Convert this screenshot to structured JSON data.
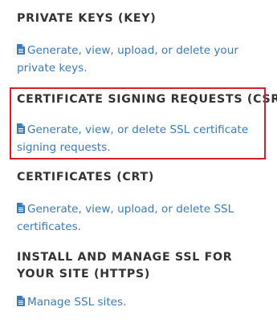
{
  "sections": [
    {
      "title": "PRIVATE KEYS (KEY)",
      "link_text": "Generate, view, upload, or delete your private keys.",
      "icon": "document-icon"
    },
    {
      "title": "CERTIFICATE SIGNING REQUESTS (CSR)",
      "link_text": "Generate, view, or delete SSL certificate signing requests.",
      "icon": "document-icon"
    },
    {
      "title": "CERTIFICATES (CRT)",
      "link_text": "Generate, view, upload, or delete SSL certificates.",
      "icon": "document-icon"
    },
    {
      "title": "INSTALL AND MANAGE SSL FOR YOUR SITE (HTTPS)",
      "link_text": "Manage SSL sites.",
      "icon": "document-icon"
    }
  ],
  "colors": {
    "heading": "#333333",
    "link": "#3a7ab7",
    "highlight_border": "#d4202a"
  }
}
